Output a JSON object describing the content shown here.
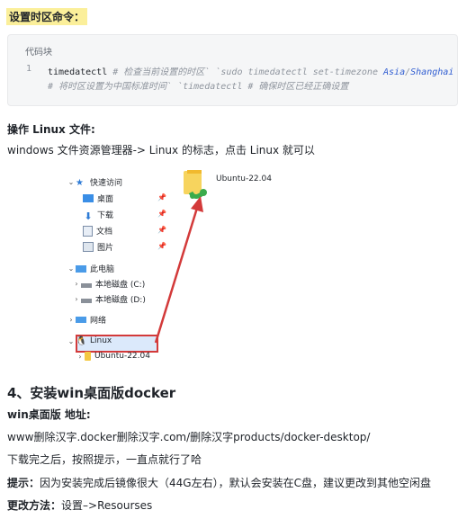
{
  "heading_timezone": "设置时区命令：",
  "code": {
    "label": "代码块",
    "line_number": "1",
    "cmd1": "timedatectl",
    "cmt1": "# 检查当前设置的时区`",
    "cmt1b": "`sudo timedatectl set-timezone",
    "tz_region": "Asia",
    "tz_sep": "/",
    "tz_city": "Shanghai",
    "cmt2": "# 将时区设置为中国标准时间`",
    "cmt2b": "`timedatectl",
    "cmt2c": "# 确保时区已经正确设置"
  },
  "heading_linux_files": "操作 Linux 文件:",
  "para_linux_files": "windows 文件资源管理器-> Linux 的标志，点击 Linux 就可以",
  "explorer": {
    "quick_access": "快速访问",
    "desktop": "桌面",
    "downloads": "下载",
    "documents": "文档",
    "pictures": "图片",
    "this_pc": "此电脑",
    "disk_c": "本地磁盘 (C:)",
    "disk_d": "本地磁盘 (D:)",
    "network": "网络",
    "linux": "Linux",
    "ubuntu_nav": "Ubuntu-22.04",
    "ubuntu_folder": "Ubuntu-22.04"
  },
  "section4_title": "4、安装win桌面版docker",
  "label_win_address": "win桌面版 地址:",
  "url_text": "www删除汉字.docker删除汉字.com/删除汉字products/docker-desktop/",
  "para_download": "下载完之后，按照提示，一直点就行了哈",
  "tip_label": "提示：",
  "tip_text": "因为安装完成后镜像很大（44G左右），默认会安装在C盘，建议更改到其他空闲盘",
  "change_label": "更改方法：",
  "change_text": "设置–>Resourses",
  "colors": {
    "highlight": "#fbef9a",
    "code_bg": "#f5f6f7",
    "arrow_red": "#d33a3a",
    "link_blue": "#2d5bd1"
  }
}
